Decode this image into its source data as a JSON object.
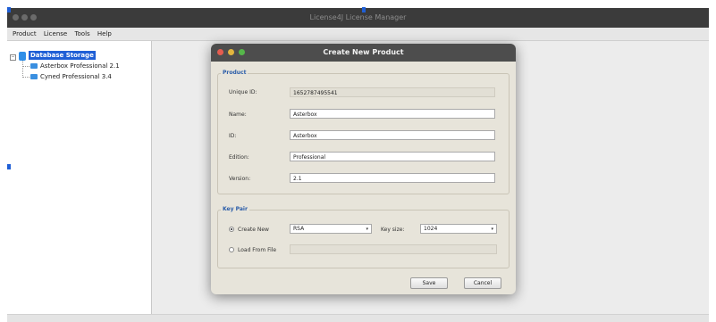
{
  "window": {
    "title": "License4J License Manager"
  },
  "menu": [
    "Product",
    "License",
    "Tools",
    "Help"
  ],
  "tree": {
    "root": "Database Storage",
    "expander": "−",
    "items": [
      "Asterbox Professional 2.1",
      "Cyned Professional 3.4"
    ]
  },
  "dialog": {
    "title": "Create New Product",
    "product_group": "Product",
    "fields": {
      "unique_id": {
        "label": "Unique ID:",
        "value": "1652787495541"
      },
      "name": {
        "label": "Name:",
        "value": "Asterbox"
      },
      "id": {
        "label": "ID:",
        "value": "Asterbox"
      },
      "edition": {
        "label": "Edition:",
        "value": "Professional"
      },
      "version": {
        "label": "Version:",
        "value": "2.1"
      }
    },
    "keypair_group": "Key Pair",
    "create_new": {
      "label": "Create New",
      "algorithm": "RSA"
    },
    "key_size": {
      "label": "Key size:",
      "value": "1024"
    },
    "load_from_file": {
      "label": "Load From File",
      "value": ""
    },
    "save_label": "Save",
    "cancel_label": "Cancel"
  },
  "colors": {
    "titlebar": "#3b3b3b",
    "selection": "#1f5fd6",
    "group_title": "#2a5ca8",
    "close_dot": "#e55c4f",
    "minimize_dot": "#e2b53e",
    "zoom_dot": "#56b64a"
  },
  "icons": {
    "arrow": "▾",
    "database": "database-icon",
    "product": "product-icon"
  }
}
